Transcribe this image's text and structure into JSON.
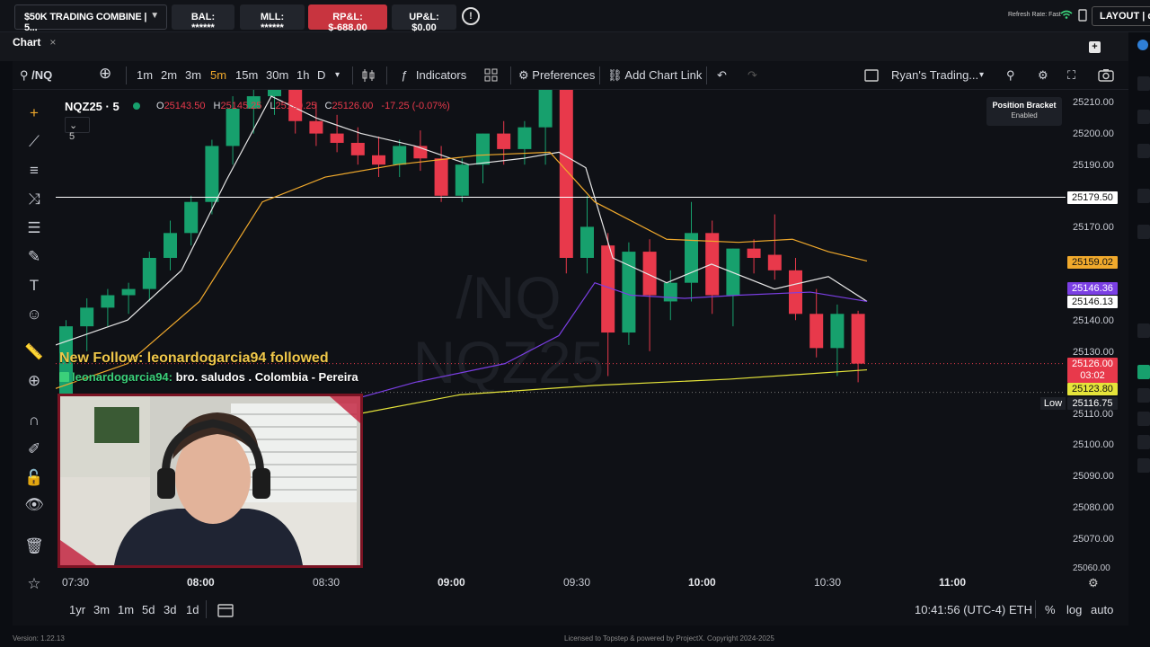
{
  "topbar": {
    "account": "$50K TRADING COMBINE | 5...",
    "balance": "BAL: ******",
    "mll": "MLL: ******",
    "rpl": "RP&L: $-688.00",
    "upl": "UP&L: $0.00",
    "refresh_rate": "Refresh Rate: Fast",
    "layout": "LAYOUT | de"
  },
  "panel": {
    "tab": "Chart"
  },
  "toolbar": {
    "symbol": "/NQ",
    "timeframes": [
      "1m",
      "2m",
      "3m",
      "5m",
      "15m",
      "30m",
      "1h",
      "D"
    ],
    "active_timeframe": "5m",
    "indicators": "Indicators",
    "preferences": "Preferences",
    "add_chart_link": "Add Chart Link",
    "template": "Ryan's Trading..."
  },
  "legend": {
    "symbol": "NQZ25 · 5",
    "o_key": "O",
    "o_val": "25143.50",
    "h_key": "H",
    "h_val": "25145.25",
    "l_key": "L",
    "l_val": "25120.25",
    "c_key": "C",
    "c_val": "25126.00",
    "change": "-17.25 (-0.07%)",
    "ma_badge": "5"
  },
  "position_bracket": {
    "title": "Position Bracket",
    "status": "Enabled"
  },
  "watermark": {
    "line1": "/NQ",
    "line2": "NQZ25"
  },
  "price_axis": [
    "25210.00",
    "25200.00",
    "25190.00",
    "25170.00",
    "25140.00",
    "25130.00",
    "25110.00",
    "25100.00",
    "25090.00",
    "25080.00",
    "25070.00",
    "25060.00"
  ],
  "price_tags": {
    "line": "25179.50",
    "orange_ma": "25159.02",
    "purple_ma": "25146.36",
    "white_ma": "25146.13",
    "last": "25126.00",
    "countdown": "03:02",
    "yellow_ma": "25123.80",
    "low": "25116.75",
    "low_label": "Low"
  },
  "time_axis": [
    "07:30",
    "08:00",
    "08:30",
    "09:00",
    "09:30",
    "10:00",
    "10:30",
    "11:00"
  ],
  "overlay": {
    "follow": "New Follow: leonardogarcia94 followed",
    "chat_user": "leonardogarcia94:",
    "chat_msg": "bro. saludos . Colombia - Pereira"
  },
  "bottombar": {
    "ranges": [
      "1yr",
      "3m",
      "1m",
      "5d",
      "3d",
      "1d"
    ],
    "clock": "10:41:56 (UTC-4)",
    "session": "ETH",
    "pct": "%",
    "log": "log",
    "auto": "auto"
  },
  "footer": {
    "version": "Version: 1.22.13",
    "license": "Licensed to Topstep & powered by ProjectX. Copyright 2024-2025"
  },
  "colors": {
    "up": "#17a06d",
    "down": "#e8394b",
    "accent": "#f0a92c",
    "purple": "#7b3fe4",
    "yellow": "#e5e43a"
  }
}
